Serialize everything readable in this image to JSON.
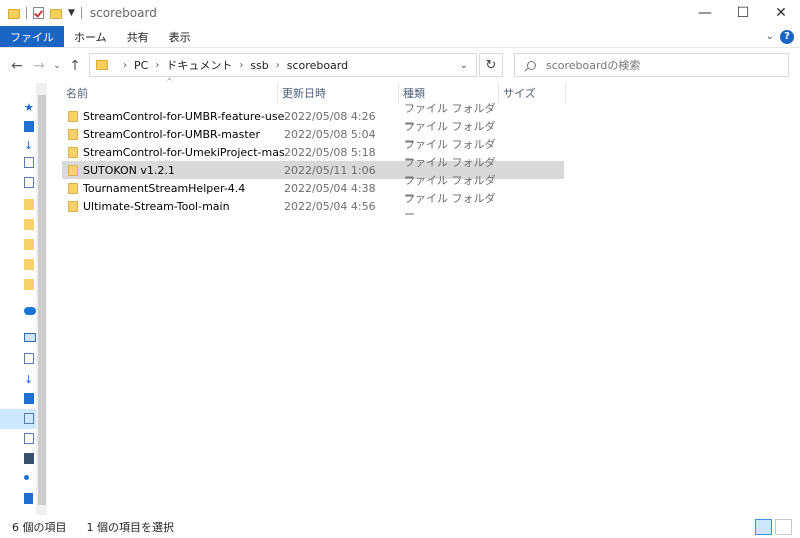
{
  "window": {
    "title": "scoreboard",
    "controls": {
      "minimize": "—",
      "maximize": "☐",
      "close": "✕"
    }
  },
  "ribbon": {
    "tabs": [
      "ファイル",
      "ホーム",
      "共有",
      "表示"
    ],
    "help": "?"
  },
  "address": {
    "crumbs": [
      "PC",
      "ドキュメント",
      "ssb",
      "scoreboard"
    ]
  },
  "search": {
    "placeholder": "scoreboardの検索"
  },
  "columns": {
    "name": "名前",
    "date": "更新日時",
    "type": "種類",
    "size": "サイズ"
  },
  "files": [
    {
      "name": "StreamControl-for-UMBR-feature-use_nu...",
      "date": "2022/05/08 4:26",
      "type": "ファイル フォルダー"
    },
    {
      "name": "StreamControl-for-UMBR-master",
      "date": "2022/05/08 5:04",
      "type": "ファイル フォルダー"
    },
    {
      "name": "StreamControl-for-UmekiProject-master",
      "date": "2022/05/08 5:18",
      "type": "ファイル フォルダー"
    },
    {
      "name": "SUTOKON v1.2.1",
      "date": "2022/05/11 1:06",
      "type": "ファイル フォルダー"
    },
    {
      "name": "TournamentStreamHelper-4.4",
      "date": "2022/05/04 4:38",
      "type": "ファイル フォルダー"
    },
    {
      "name": "Ultimate-Stream-Tool-main",
      "date": "2022/05/04 4:56",
      "type": "ファイル フォルダー"
    }
  ],
  "status": {
    "item_count": "6 個の項目",
    "selected": "1 個の項目を選択"
  },
  "colors": {
    "file_tab": "#1a64c4",
    "folder": "#f8d16a",
    "selected_row": "#d9d9d9",
    "header_text": "#4c607a"
  }
}
